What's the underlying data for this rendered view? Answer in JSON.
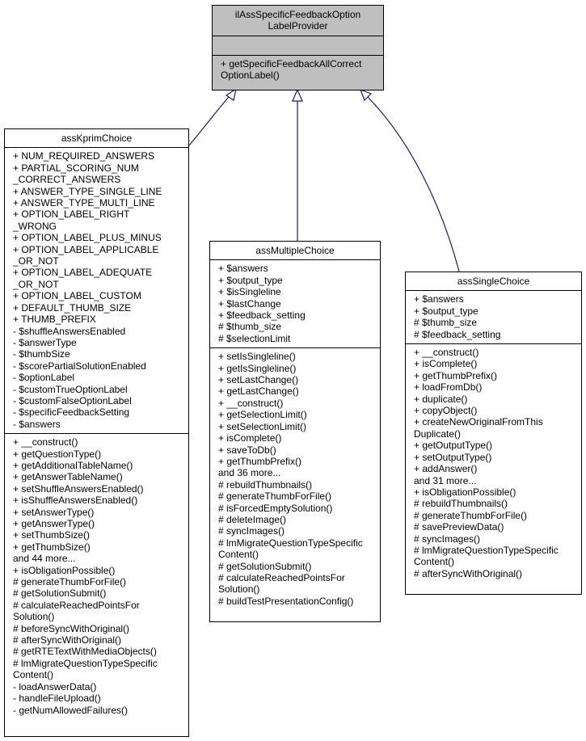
{
  "diagram": {
    "type": "uml-class-inheritance",
    "edge_color": "#191970",
    "base_class": {
      "name": [
        "ilAssSpecificFeedbackOption",
        "LabelProvider"
      ],
      "attributes": [],
      "methods": [
        "+ getSpecificFeedbackAllCorrect",
        "OptionLabel()"
      ]
    },
    "classes": [
      {
        "name": [
          "assKprimChoice"
        ],
        "attributes": [
          "+ NUM_REQUIRED_ANSWERS",
          "+ PARTIAL_SCORING_NUM",
          "_CORRECT_ANSWERS",
          "+ ANSWER_TYPE_SINGLE_LINE",
          "+ ANSWER_TYPE_MULTI_LINE",
          "+ OPTION_LABEL_RIGHT",
          "_WRONG",
          "+ OPTION_LABEL_PLUS_MINUS",
          "+ OPTION_LABEL_APPLICABLE",
          "_OR_NOT",
          "+ OPTION_LABEL_ADEQUATE",
          "_OR_NOT",
          "+ OPTION_LABEL_CUSTOM",
          "+ DEFAULT_THUMB_SIZE",
          "+ THUMB_PREFIX",
          "- $shuffleAnswersEnabled",
          "- $answerType",
          "- $thumbSize",
          "- $scorePartialSolutionEnabled",
          "- $optionLabel",
          "- $customTrueOptionLabel",
          "- $customFalseOptionLabel",
          "- $specificFeedbackSetting",
          "- $answers"
        ],
        "methods": [
          "+ __construct()",
          "+ getQuestionType()",
          "+ getAdditionalTableName()",
          "+ getAnswerTableName()",
          "+ setShuffleAnswersEnabled()",
          "+ isShuffleAnswersEnabled()",
          "+ setAnswerType()",
          "+ getAnswerType()",
          "+ setThumbSize()",
          "+ getThumbSize()",
          "and 44 more...",
          "+ isObligationPossible()",
          "# generateThumbForFile()",
          "# getSolutionSubmit()",
          "# calculateReachedPointsFor",
          "Solution()",
          "# beforeSyncWithOriginal()",
          "# afterSyncWithOriginal()",
          "# getRTETextWithMediaObjects()",
          "# lmMigrateQuestionTypeSpecific",
          "Content()",
          "- loadAnswerData()",
          "- handleFileUpload()",
          "- getNumAllowedFailures()"
        ]
      },
      {
        "name": [
          "assMultipleChoice"
        ],
        "attributes": [
          "+ $answers",
          "+ $output_type",
          "+ $isSingleline",
          "+ $lastChange",
          "+ $feedback_setting",
          "# $thumb_size",
          "# $selectionLimit"
        ],
        "methods": [
          "+ setIsSingleline()",
          "+ getIsSingleline()",
          "+ setLastChange()",
          "+ getLastChange()",
          "+ __construct()",
          "+ getSelectionLimit()",
          "+ setSelectionLimit()",
          "+ isComplete()",
          "+ saveToDb()",
          "+ getThumbPrefix()",
          "and 36 more...",
          "# rebuildThumbnails()",
          "# generateThumbForFile()",
          "# isForcedEmptySolution()",
          "# deleteImage()",
          "# syncImages()",
          "# lmMigrateQuestionTypeSpecific",
          "Content()",
          "# getSolutionSubmit()",
          "# calculateReachedPointsFor",
          "Solution()",
          "# buildTestPresentationConfig()"
        ]
      },
      {
        "name": [
          "assSingleChoice"
        ],
        "attributes": [
          "+ $answers",
          "+ $output_type",
          "# $thumb_size",
          "# $feedback_setting"
        ],
        "methods": [
          "+ __construct()",
          "+ isComplete()",
          "+ getThumbPrefix()",
          "+ loadFromDb()",
          "+ duplicate()",
          "+ copyObject()",
          "+ createNewOriginalFromThis",
          "Duplicate()",
          "+ getOutputType()",
          "+ setOutputType()",
          "+ addAnswer()",
          "and 31 more...",
          "+ isObligationPossible()",
          "# rebuildThumbnails()",
          "# generateThumbForFile()",
          "# savePreviewData()",
          "# syncImages()",
          "# lmMigrateQuestionTypeSpecific",
          "Content()",
          "# afterSyncWithOriginal()"
        ]
      }
    ]
  }
}
